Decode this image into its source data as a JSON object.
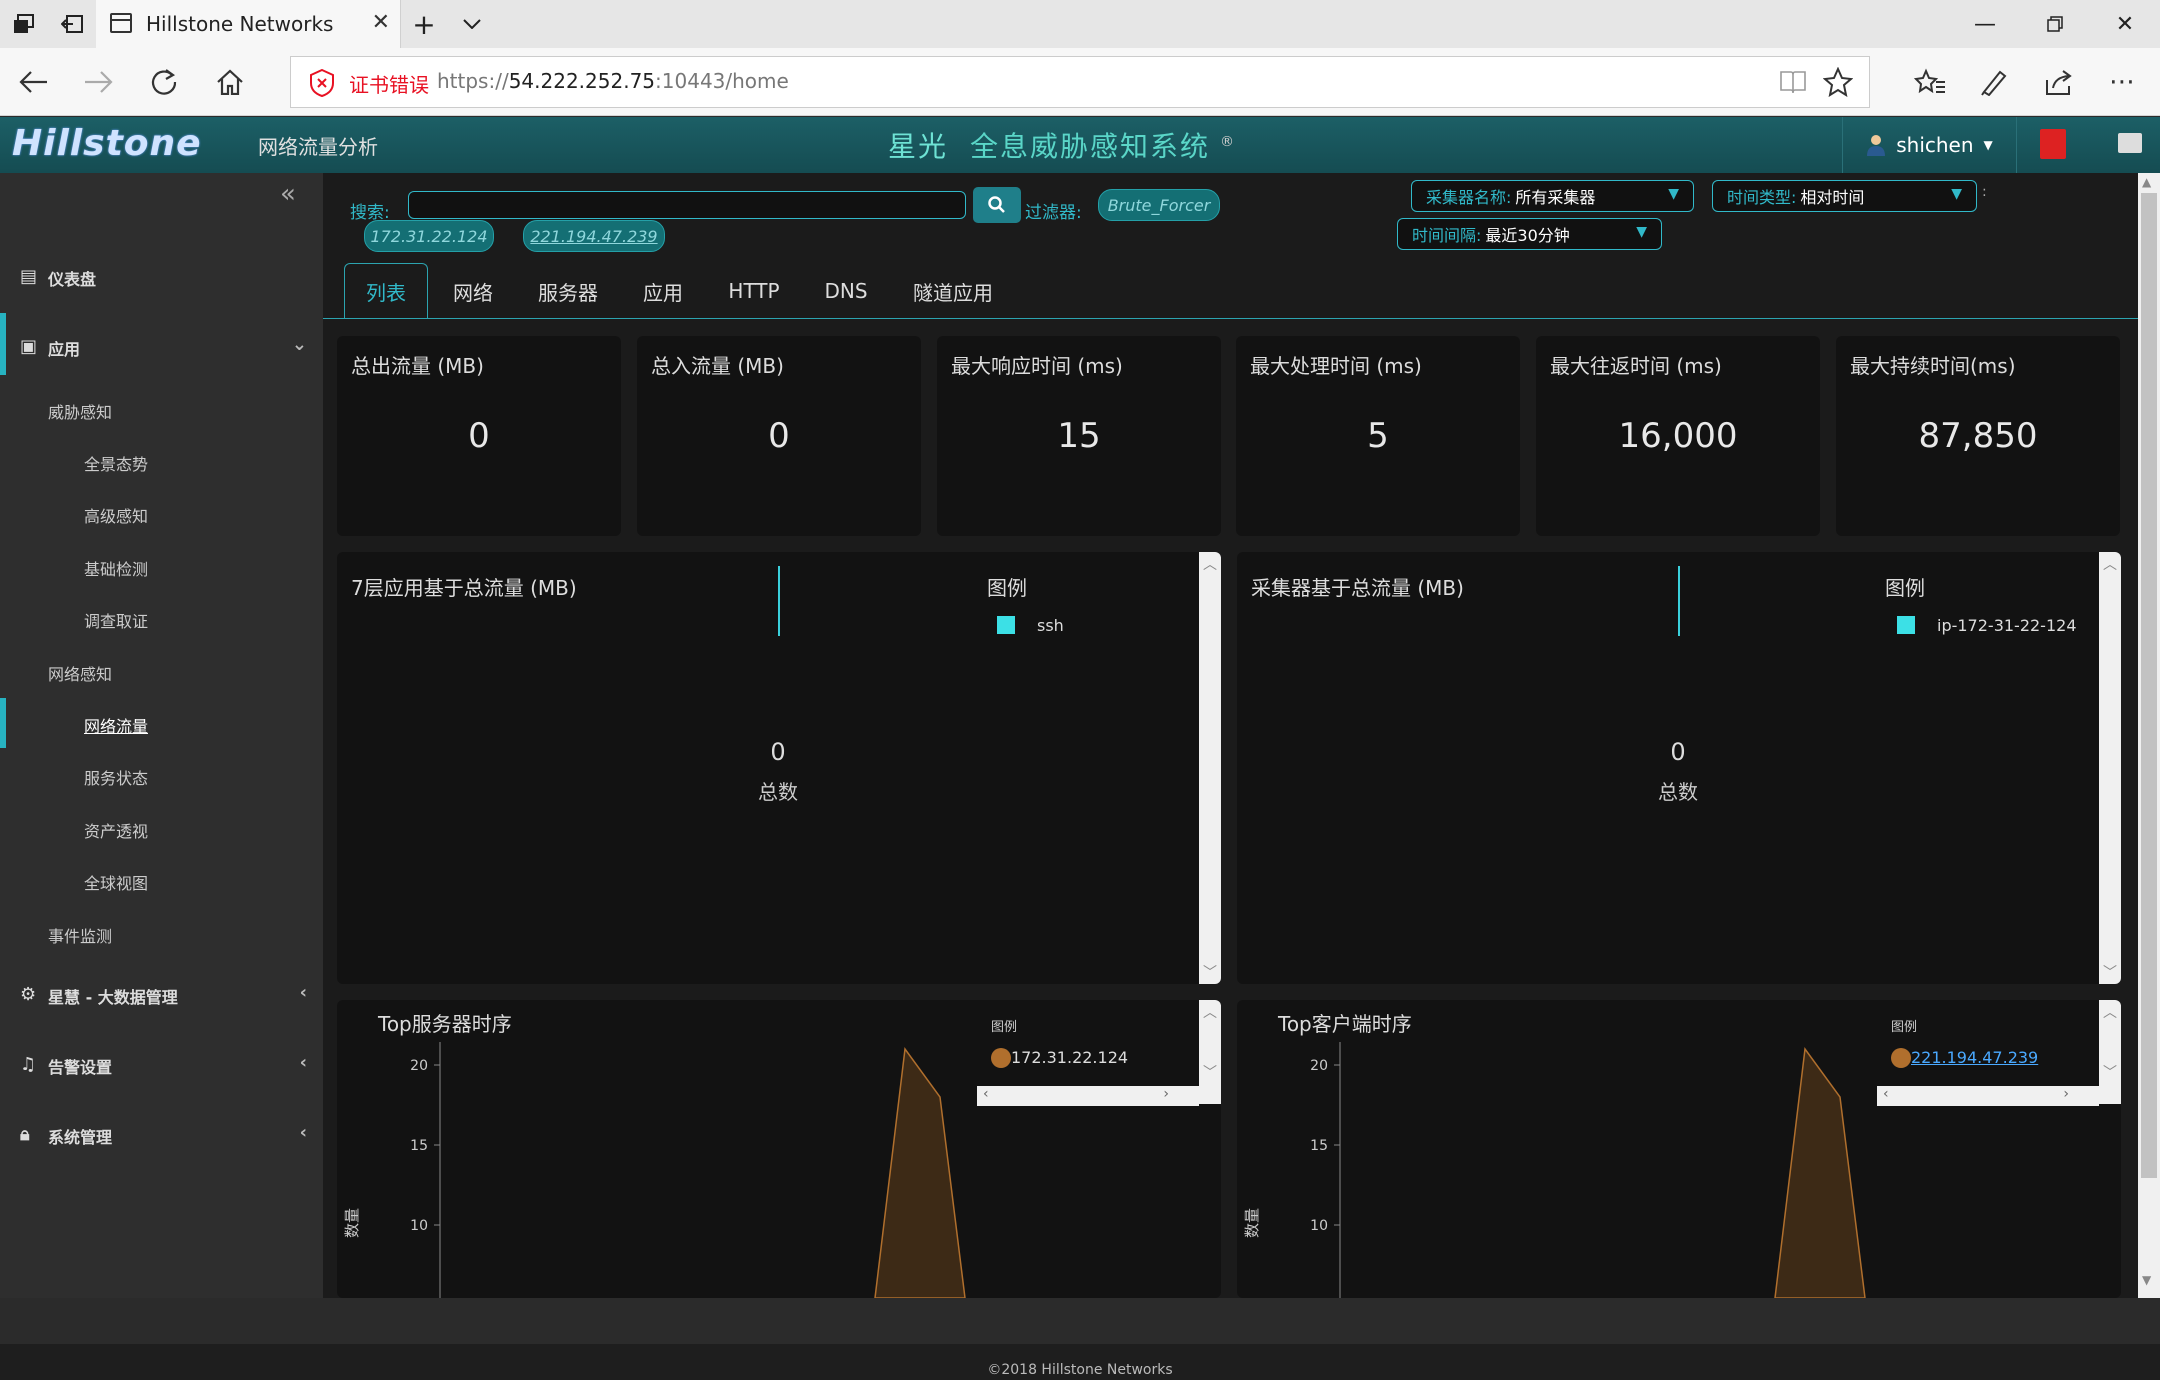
{
  "browser": {
    "tab_title": "Hillstone Networks",
    "cert_error": "证书错误",
    "url_prefix": "https://",
    "url_host": "54.222.252.75",
    "url_rest": ":10443/home"
  },
  "app": {
    "logo": "Hillstone",
    "subtitle": "网络流量分析",
    "sys_brand": "星光",
    "sys_name": "全息威胁感知系统",
    "sys_mark": "®",
    "user": "shichen"
  },
  "sidebar": {
    "dashboard": "仪表盘",
    "app": "应用",
    "threat": "威胁感知",
    "panorama": "全景态势",
    "advanced": "高级感知",
    "basic": "基础检测",
    "investigate": "调查取证",
    "netaware": "网络感知",
    "netflow": "网络流量",
    "svcstatus": "服务状态",
    "asset": "资产透视",
    "globalview": "全球视图",
    "events": "事件监测",
    "bigdata": "星慧 - 大数据管理",
    "alerts": "告警设置",
    "system": "系统管理"
  },
  "toolbar": {
    "search_label": "搜索:",
    "filter_label": "过滤器:",
    "filter_chip": "Brute_Forcer",
    "chips": [
      "172.31.22.124",
      "221.194.47.239"
    ],
    "collector_k": "采集器名称:",
    "collector_v": "所有采集器",
    "timetype_k": "时间类型:",
    "timetype_v": "相对时间",
    "interval_k": "时间间隔:",
    "interval_v": "最近30分钟"
  },
  "tabs": [
    "列表",
    "网络",
    "服务器",
    "应用",
    "HTTP",
    "DNS",
    "隧道应用"
  ],
  "stats": [
    {
      "t": "总出流量 (MB)",
      "v": "0"
    },
    {
      "t": "总入流量 (MB)",
      "v": "0"
    },
    {
      "t": "最大响应时间 (ms)",
      "v": "15"
    },
    {
      "t": "最大处理时间 (ms)",
      "v": "5"
    },
    {
      "t": "最大往返时间 (ms)",
      "v": "16,000"
    },
    {
      "t": "最大持续时间(ms)",
      "v": "87,850"
    }
  ],
  "donut1": {
    "title": "7层应用基于总流量 (MB)",
    "legend": "图例",
    "item": "ssh",
    "total": "0",
    "total_label": "总数"
  },
  "donut2": {
    "title": "采集器基于总流量 (MB)",
    "legend": "图例",
    "item": "ip-172-31-22-124",
    "total": "0",
    "total_label": "总数"
  },
  "ts1": {
    "title": "Top服务器时序",
    "legend": "图例",
    "item": "172.31.22.124",
    "ylabel": "数量"
  },
  "ts2": {
    "title": "Top客户端时序",
    "legend": "图例",
    "item": "221.194.47.239",
    "ylabel": "数量"
  },
  "chart_data": [
    {
      "type": "area",
      "title": "Top服务器时序",
      "ylabel": "数量",
      "ytick_labels": [
        "20",
        "15",
        "10"
      ],
      "series": [
        {
          "name": "172.31.22.124",
          "peak": 21,
          "values": [
            0,
            21,
            18,
            0
          ]
        }
      ]
    },
    {
      "type": "area",
      "title": "Top客户端时序",
      "ylabel": "数量",
      "ytick_labels": [
        "20",
        "15",
        "10"
      ],
      "series": [
        {
          "name": "221.194.47.239",
          "peak": 21,
          "values": [
            0,
            21,
            18,
            0
          ]
        }
      ]
    }
  ],
  "footer": "©2018 Hillstone Networks"
}
